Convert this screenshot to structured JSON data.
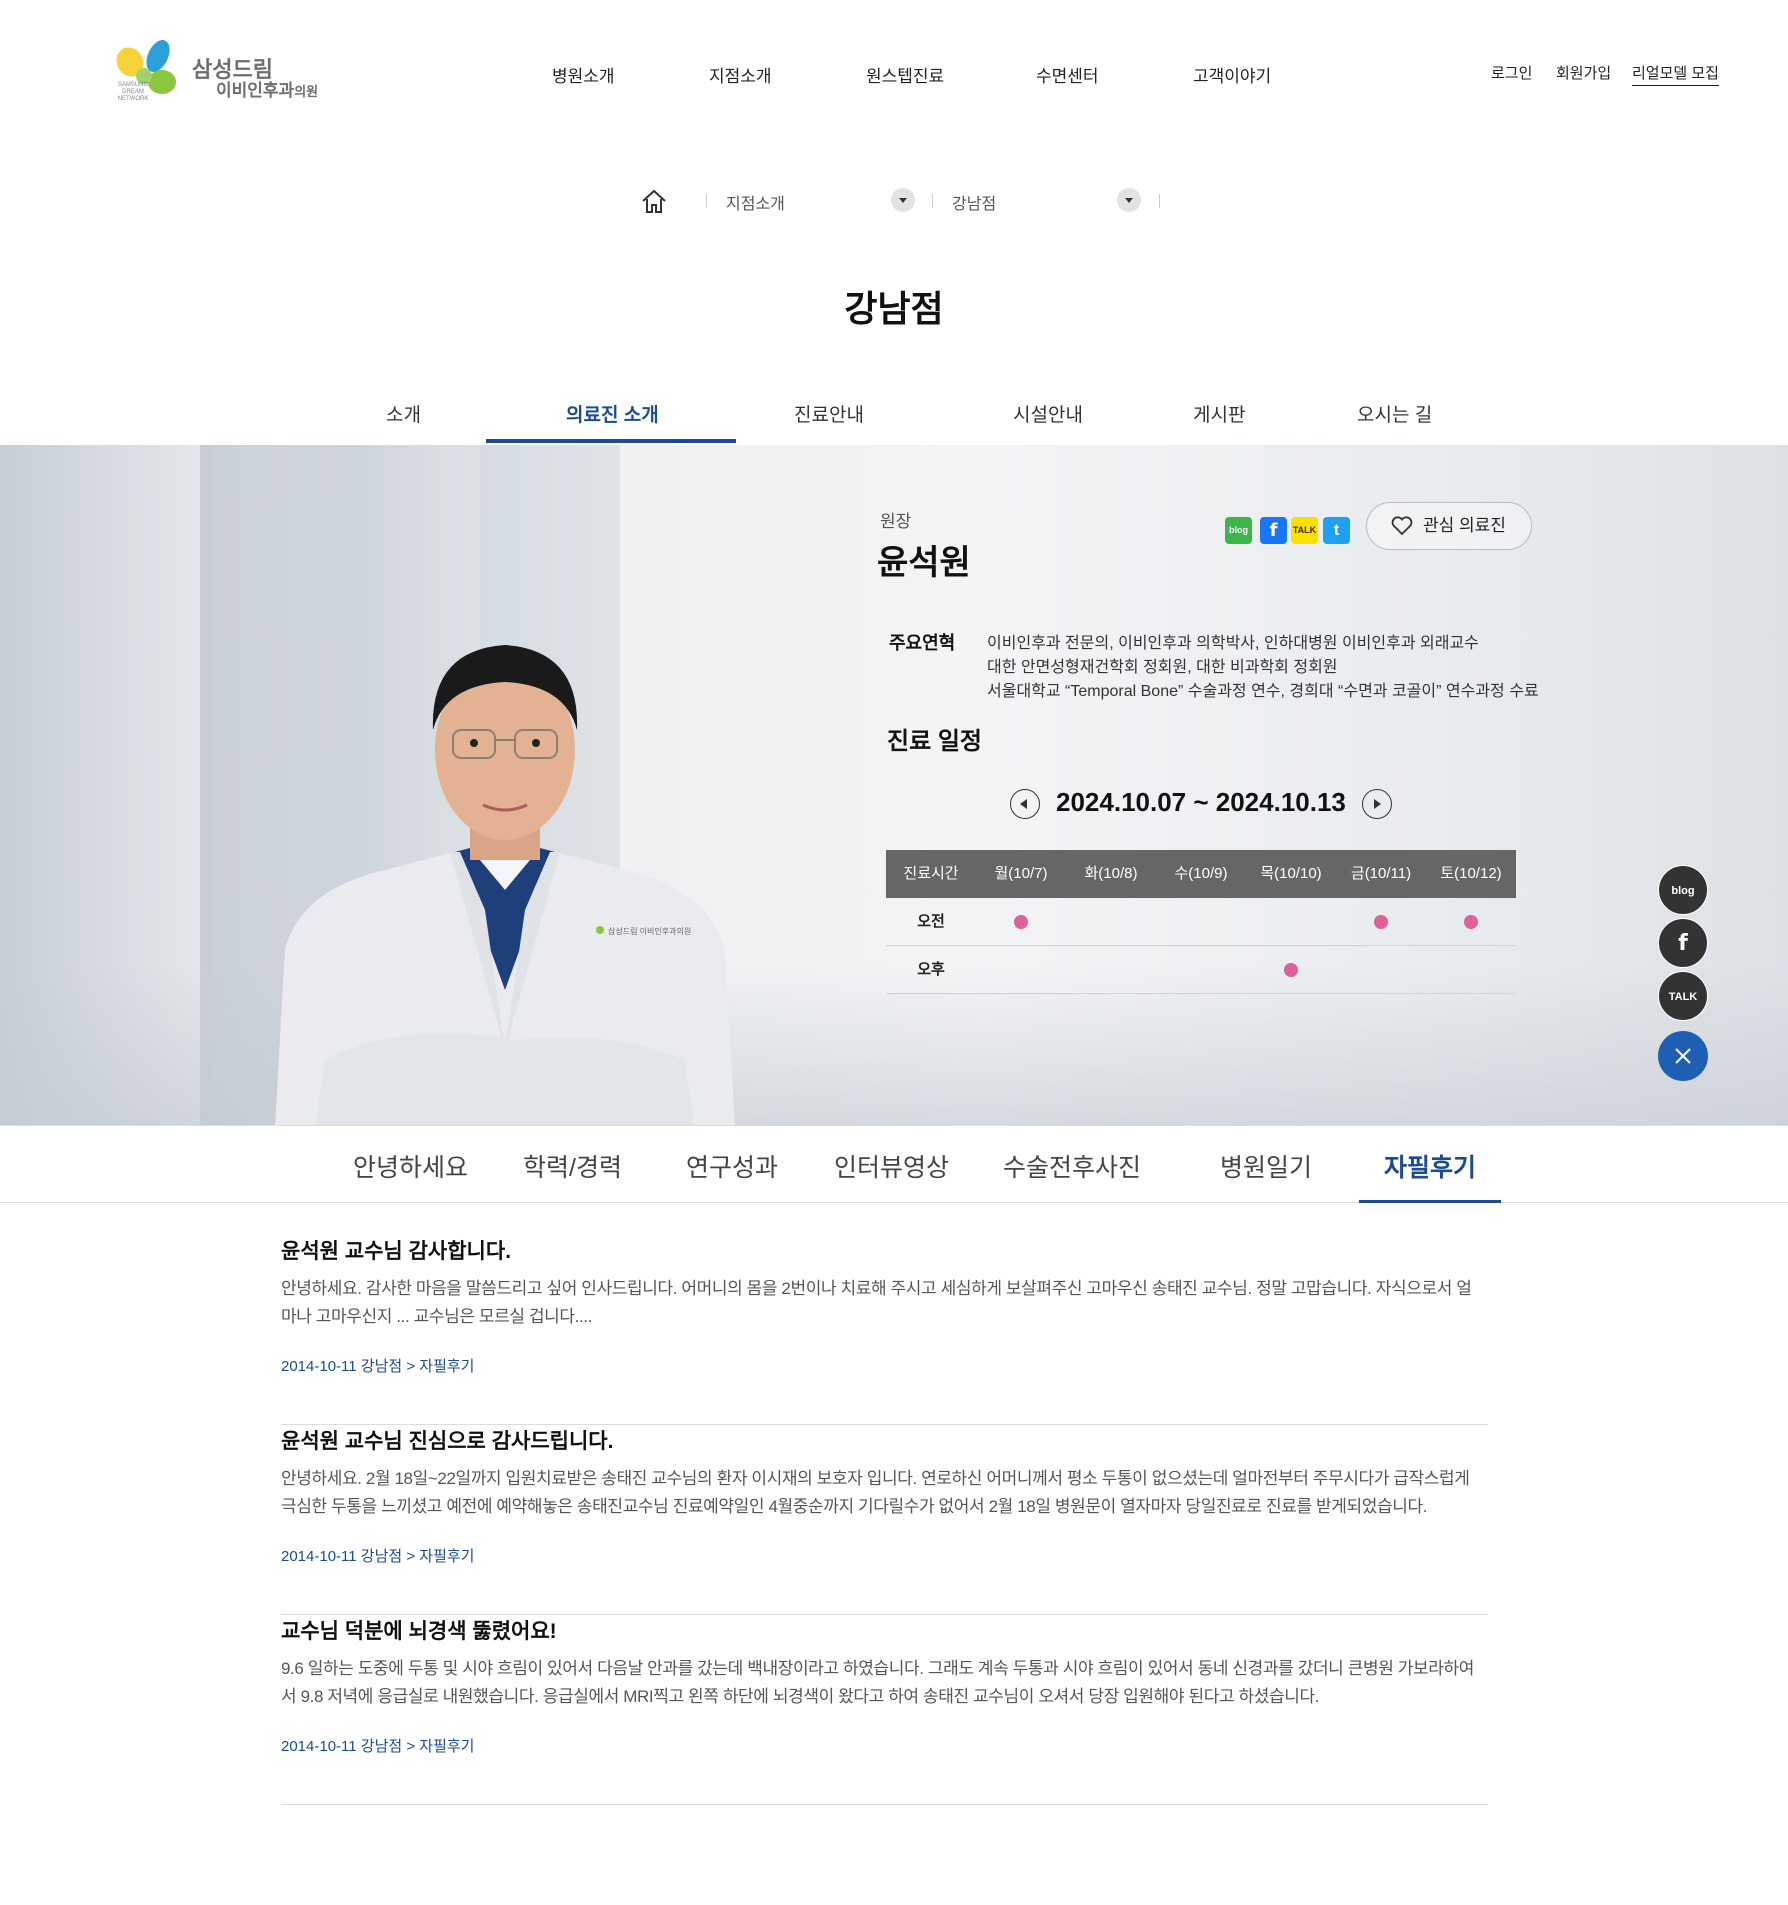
{
  "logo": {
    "title": "삼성드림",
    "subtitle": "이비인후과",
    "subtitle_small": "의원",
    "network": "SAMSUNG DREAM NETWORK"
  },
  "gnb": [
    "병원소개",
    "지점소개",
    "원스텝진료",
    "수면센터",
    "고객이야기"
  ],
  "util": {
    "login": "로그인",
    "join": "회원가입",
    "model": "리얼모델 모집"
  },
  "breadcrumb": {
    "level1": "지점소개",
    "level2": "강남점"
  },
  "page_title": "강남점",
  "tabs": [
    "소개",
    "의료진 소개",
    "진료안내",
    "시설안내",
    "게시판",
    "오시는 길"
  ],
  "doctor": {
    "role": "원장",
    "name": "윤석원",
    "fav_label": "관심 의료진",
    "career_label": "주요연혁",
    "career": [
      "이비인후과 전문의, 이비인후과 의학박사, 인하대병원 이비인후과 외래교수",
      "대한 안면성형재건학회 정회원, 대한 비과학회 정회원",
      "서울대학교 “Temporal Bone” 수술과정 연수, 경희대 “수면과 코골이” 연수과정 수료"
    ],
    "coat_logo": "삼성드림 이비인후과의원"
  },
  "sns": {
    "blog": "blog",
    "facebook": "f",
    "talk": "TALK",
    "twitter": "t"
  },
  "schedule": {
    "title": "진료 일정",
    "range": "2024.10.07 ~ 2024.10.13",
    "head": [
      "진료시간",
      "월(10/7)",
      "화(10/8)",
      "수(10/9)",
      "목(10/10)",
      "금(10/11)",
      "토(10/12)"
    ],
    "rows": [
      {
        "label": "오전",
        "slots": [
          true,
          false,
          false,
          false,
          true,
          true
        ]
      },
      {
        "label": "오후",
        "slots": [
          false,
          false,
          false,
          true,
          false,
          false
        ]
      }
    ],
    "dot_color": "#e0609a"
  },
  "quick": {
    "blog": "blog",
    "facebook": "f",
    "talk": "TALK"
  },
  "subtabs": [
    "안녕하세요",
    "학력/경력",
    "연구성과",
    "인터뷰영상",
    "수술전후사진",
    "병원일기",
    "자필후기"
  ],
  "reviews": [
    {
      "title": "윤석원 교수님 감사합니다.",
      "body": "안녕하세요. 감사한 마음을 말씀드리고 싶어 인사드립니다. 어머니의 몸을 2번이나 치료해 주시고 세심하게 보살펴주신 고마우신 송태진 교수님. 정말 고맙습니다. 자식으로서 얼마나 고마우신지 ... 교수님은 모르실 겁니다....",
      "meta": "2014-10-11  강남점 > 자필후기"
    },
    {
      "title": "윤석원 교수님 진심으로 감사드립니다.",
      "body": "안녕하세요. 2월 18일~22일까지 입원치료받은 송태진 교수님의 환자 이시재의 보호자 입니다. 연로하신 어머니께서 평소 두통이 없으셨는데 얼마전부터 주무시다가 급작스럽게 극심한 두통을 느끼셨고 예전에 예약해놓은 송태진교수님 진료예약일인 4월중순까지 기다릴수가 없어서 2월 18일 병원문이 열자마자 당일진료로 진료를 받게되었습니다.",
      "meta": "2014-10-11  강남점 > 자필후기"
    },
    {
      "title": "교수님 덕분에 뇌경색 뚫렸어요!",
      "body": "9.6 일하는 도중에 두통 및 시야 흐림이 있어서 다음날 안과를 갔는데 백내장이라고 하였습니다. 그래도 계속 두통과 시야 흐림이 있어서 동네 신경과를 갔더니 큰병원 가보라하여서 9.8 저녁에 응급실로 내원했습니다. 응급실에서 MRI찍고 왼쪽 하단에 뇌경색이 왔다고 하여 송태진 교수님이 오셔서 당장 입원해야 된다고 하셨습니다.",
      "meta": "2014-10-11  강남점 > 자필후기"
    }
  ]
}
